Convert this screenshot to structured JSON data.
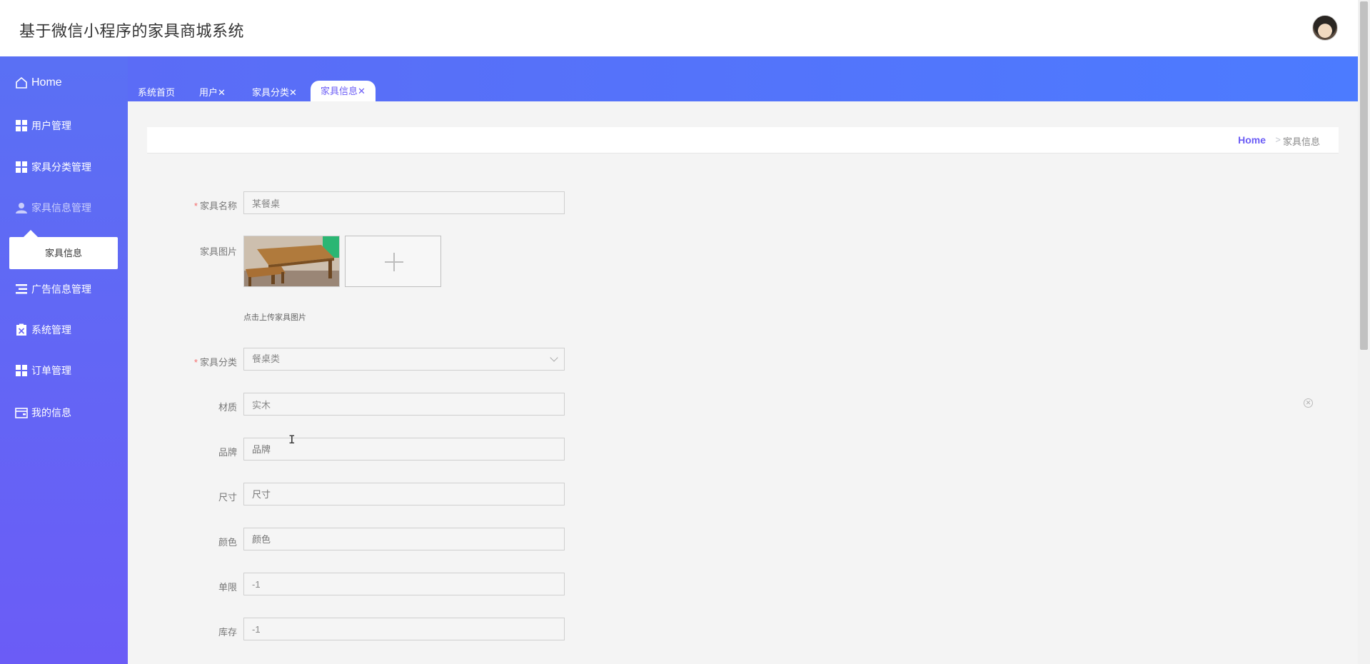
{
  "header": {
    "app_title": "基于微信小程序的家具商城系统"
  },
  "sidebar": {
    "home_label": "Home",
    "items": [
      {
        "label": "用户管理",
        "icon": "grid-icon"
      },
      {
        "label": "家具分类管理",
        "icon": "grid-icon"
      },
      {
        "label": "家具信息管理",
        "icon": "user-icon"
      },
      {
        "label": "广告信息管理",
        "icon": "list-icon"
      },
      {
        "label": "系统管理",
        "icon": "clipboard-icon"
      },
      {
        "label": "订单管理",
        "icon": "grid-icon"
      },
      {
        "label": "我的信息",
        "icon": "wallet-icon"
      }
    ],
    "submenu_item": "家具信息"
  },
  "tabs": [
    {
      "label": "系统首页"
    },
    {
      "label": "用户✕"
    },
    {
      "label": "家具分类✕"
    },
    {
      "label": "家具信息✕",
      "active": true
    }
  ],
  "breadcrumb": {
    "home": "Home",
    "separator": ">",
    "current": "家具信息"
  },
  "form": {
    "name": {
      "label": "家具名称",
      "required": true,
      "value": "某餐桌"
    },
    "image": {
      "label": "家具图片",
      "tip": "点击上传家具图片"
    },
    "category": {
      "label": "家具分类",
      "required": true,
      "value": "餐桌类"
    },
    "material": {
      "label": "材质",
      "value": "实木"
    },
    "brand": {
      "label": "品牌",
      "placeholder": "品牌"
    },
    "size": {
      "label": "尺寸",
      "placeholder": "尺寸"
    },
    "color": {
      "label": "颜色",
      "placeholder": "颜色"
    },
    "limit": {
      "label": "单限",
      "value": "-1"
    },
    "stock": {
      "label": "库存",
      "value": "-1"
    }
  },
  "colors": {
    "accent": "#6b5cf6",
    "sidebar_top": "#5a70f4",
    "tabbar": "#4c7bff",
    "required": "#f56c6c"
  }
}
